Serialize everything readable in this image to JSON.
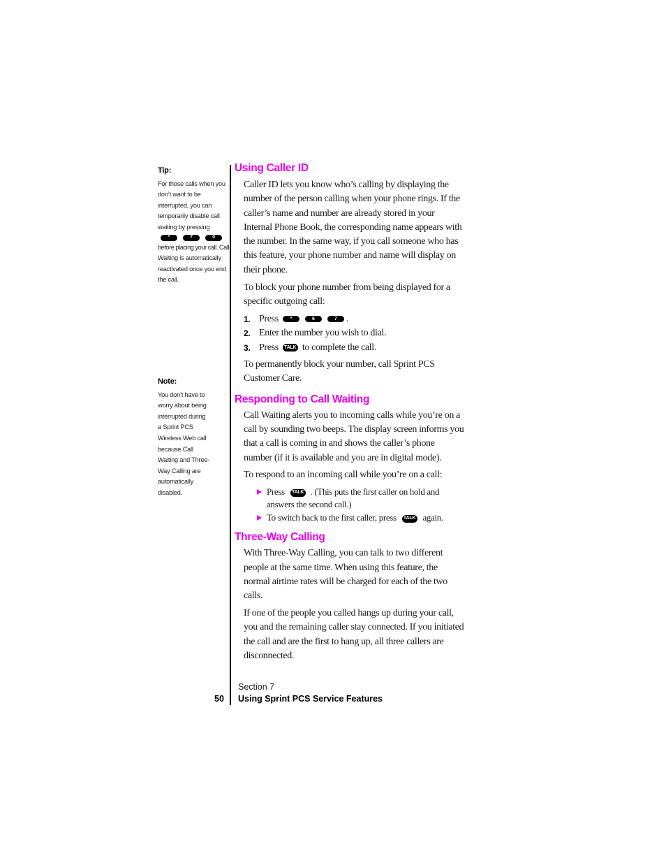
{
  "sidebar": {
    "tip": {
      "label": "Tip:",
      "lines_before": [
        "For those calls when you",
        "don’t want to be",
        "interrupted, you can",
        "temporarily disable call",
        "waiting by pressing"
      ],
      "keys": [
        "*",
        "7",
        "0"
      ],
      "lines_after": [
        "before placing your call. Call",
        "Waiting is automatically",
        "reactivated once you end",
        "the call."
      ]
    },
    "note": {
      "label": "Note:",
      "lines": [
        "You don’t have to",
        "worry about being",
        "interrupted during",
        "a Sprint PCS",
        "Wireless Web call",
        "because Call",
        "Waiting and Three-",
        "Way Calling are",
        "automatically",
        "disabled."
      ]
    }
  },
  "sections": {
    "caller_id": {
      "heading": "Using Caller ID",
      "para1": "Caller ID lets you know who’s calling by displaying the number of the person calling when your phone rings. If the caller’s name and number are already stored in your Internal Phone Book, the corresponding name appears with the number. In the same way, if you call someone who has this feature, your phone number and name will display on their phone.",
      "para2": "To block your phone number from being displayed for a specific outgoing call:",
      "steps": [
        {
          "num": "1.",
          "text_before": "Press",
          "keys": [
            "*",
            "6",
            "7"
          ],
          "text_after": "."
        },
        {
          "num": "2.",
          "text_before": "Enter the number you wish to dial.",
          "keys": [],
          "text_after": ""
        },
        {
          "num": "3.",
          "text_before": "Press",
          "keys": [
            "TALK"
          ],
          "text_after": "to complete the call."
        }
      ],
      "para3": "To permanently block your number, call Sprint PCS Customer Care."
    },
    "call_waiting": {
      "heading": "Responding to Call Waiting",
      "para1": "Call Waiting alerts you to incoming calls while you’re on a call by sounding two beeps. The display screen informs you that a call is coming in and shows the caller’s phone number (if it is available and you are in digital mode).",
      "para2": "To respond to an incoming call while you’re on a call:",
      "bullets": [
        {
          "text_before": "Press",
          "key": "TALK",
          "text_after": ". (This puts the first caller on hold and answers the second call.)"
        },
        {
          "text_before": "To switch back to the first caller, press",
          "key": "TALK",
          "text_after": "again."
        }
      ]
    },
    "three_way": {
      "heading": "Three-Way Calling",
      "para1": "With Three-Way Calling, you can talk to two different people at the same time. When using this feature, the normal airtime rates will be charged for each of the two calls.",
      "para2": "If one of the people you called hangs up during your call, you and the remaining caller stay connected. If you initiated the call and are the first to hang up, all three callers are disconnected."
    }
  },
  "footer": {
    "page_number": "50",
    "section_label": "Section 7",
    "section_title": "Using Sprint PCS Service Features"
  },
  "colors": {
    "heading": "#ee00ee",
    "bullet_arrow": "#ee00ee",
    "key_bg": "#000000",
    "key_text": "#ffffff"
  }
}
